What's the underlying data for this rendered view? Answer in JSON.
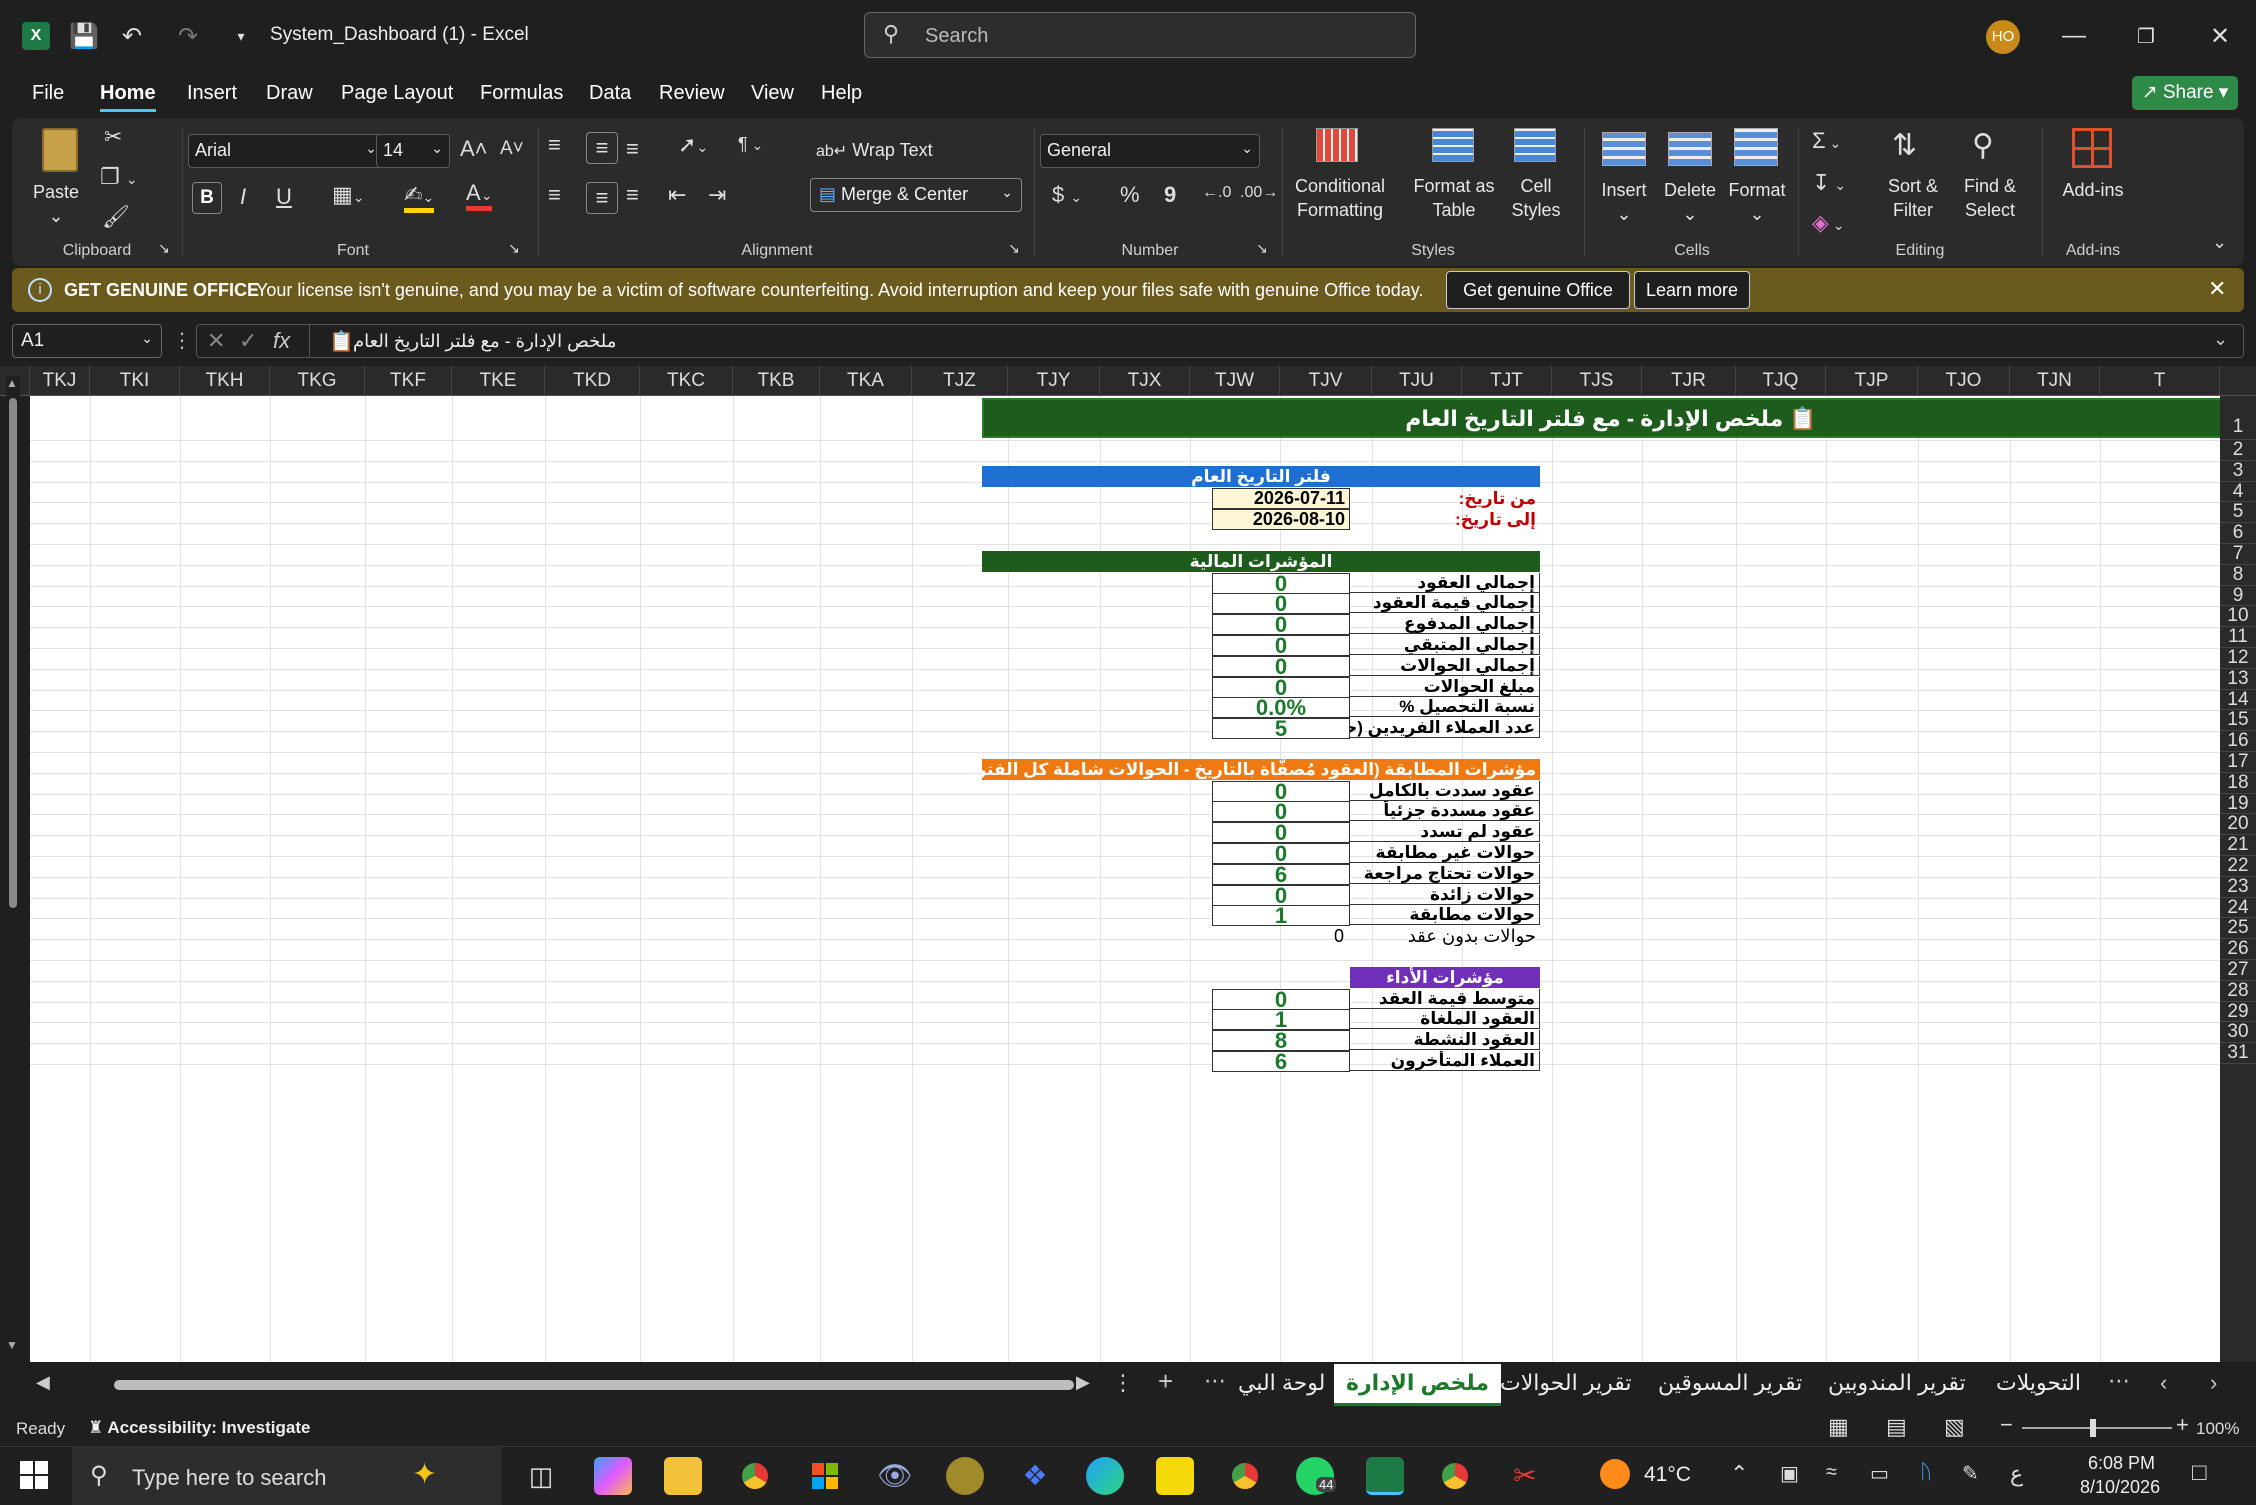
{
  "titlebar": {
    "filename": "System_Dashboard (1)",
    "app": "Excel",
    "search_placeholder": "Search",
    "user_initials": "HO"
  },
  "menu": {
    "items": [
      "File",
      "Home",
      "Insert",
      "Draw",
      "Page Layout",
      "Formulas",
      "Data",
      "Review",
      "View",
      "Help"
    ],
    "active": "Home",
    "share": "Share"
  },
  "ribbon": {
    "clipboard": {
      "paste": "Paste",
      "label": "Clipboard"
    },
    "font": {
      "name": "Arial",
      "size": "14",
      "label": "Font",
      "bold": "B",
      "italic": "I",
      "underline": "U"
    },
    "alignment": {
      "wrap": "Wrap Text",
      "merge": "Merge & Center",
      "label": "Alignment"
    },
    "number": {
      "format": "General",
      "label": "Number",
      "currency": "$",
      "percent": "%",
      "comma": "9"
    },
    "styles": {
      "conditional": "Conditional\nFormatting",
      "format_table": "Format as\nTable",
      "cell_styles": "Cell\nStyles",
      "label": "Styles"
    },
    "cells": {
      "insert": "Insert",
      "delete": "Delete",
      "format": "Format",
      "label": "Cells"
    },
    "editing": {
      "sort": "Sort &\nFilter",
      "find": "Find &\nSelect",
      "label": "Editing"
    },
    "addins": {
      "addins": "Add-ins",
      "label": "Add-ins"
    }
  },
  "notice": {
    "title": "GET GENUINE OFFICE",
    "message": "Your license isn't genuine, and you may be a victim of software counterfeiting. Avoid interruption and keep your files safe with genuine Office today.",
    "btn_primary": "Get genuine Office",
    "btn_secondary": "Learn more"
  },
  "formula_bar": {
    "name_box": "A1",
    "content": "ملخص الإدارة - مع فلتر التاريخ العام"
  },
  "columns": [
    "TKJ",
    "TKI",
    "TKH",
    "TKG",
    "TKF",
    "TKE",
    "TKD",
    "TKC",
    "TKB",
    "TKA",
    "TJZ",
    "TJY",
    "TJX",
    "TJW",
    "TJV",
    "TJU",
    "TJT",
    "TJS",
    "TJR",
    "TJQ",
    "TJP",
    "TJO",
    "TJN",
    "T"
  ],
  "rows": [
    "1",
    "2",
    "3",
    "4",
    "5",
    "6",
    "7",
    "8",
    "9",
    "10",
    "11",
    "12",
    "13",
    "14",
    "15",
    "16",
    "17",
    "18",
    "19",
    "20",
    "21",
    "22",
    "23",
    "24",
    "25",
    "26",
    "27",
    "28",
    "29",
    "30",
    "31"
  ],
  "sheet": {
    "title": "ملخص الإدارة - مع فلتر التاريخ العام",
    "date_filter_header": "فلتر التاريخ العام",
    "from_label": "من تاريخ:",
    "from_value": "2026-07-11",
    "to_label": "إلى تاريخ:",
    "to_value": "2026-08-10",
    "financial_header": "المؤشرات المالية",
    "financial": [
      {
        "label": "إجمالي العقود",
        "value": "0"
      },
      {
        "label": "إجمالي قيمة العقود",
        "value": "0"
      },
      {
        "label": "إجمالي المدفوع",
        "value": "0"
      },
      {
        "label": "إجمالي المتبقي",
        "value": "0"
      },
      {
        "label": "إجمالي الحوالات",
        "value": "0"
      },
      {
        "label": "مبلغ الحوالات",
        "value": "0"
      },
      {
        "label": "نسبة التحصيل %",
        "value": "0.0%"
      },
      {
        "label": "عدد العملاء الفريدين (حسب رقم العميل في",
        "value": "5"
      }
    ],
    "matching_header": "مؤشرات المطابقة  (العقود مُصفّاة بالتاريخ - الحوالات شاملة كل الفترات)",
    "matching": [
      {
        "label": "عقود سددت بالكامل",
        "value": "0"
      },
      {
        "label": "عقود مسددة جزئياً",
        "value": "0"
      },
      {
        "label": "عقود لم تسدد",
        "value": "0"
      },
      {
        "label": "حوالات غير مطابقة",
        "value": "0"
      },
      {
        "label": "حوالات تحتاج مراجعة",
        "value": "6"
      },
      {
        "label": "حوالات زائدة",
        "value": "0"
      },
      {
        "label": "حوالات مطابقة",
        "value": "1"
      }
    ],
    "no_contract_label": "حوالات بدون عقد",
    "no_contract_value": "0",
    "performance_header": "مؤشرات الأداء",
    "performance": [
      {
        "label": "متوسط قيمة العقد",
        "value": "0"
      },
      {
        "label": "العقود الملغاة",
        "value": "1"
      },
      {
        "label": "العقود النشطة",
        "value": "8"
      },
      {
        "label": "العملاء المتأخرون",
        "value": "6"
      }
    ]
  },
  "sheet_tabs": [
    "لوحة البي",
    "ملخص الإدارة",
    "تقرير الحوالات",
    "تقرير المسوقين",
    "تقرير المندوبين",
    "التحويلات"
  ],
  "active_sheet": "ملخص الإدارة",
  "status": {
    "ready": "Ready",
    "accessibility": "Accessibility: Investigate",
    "zoom": "100%"
  },
  "taskbar": {
    "search_placeholder": "Type here to search",
    "temperature": "41°C",
    "time": "6:08 PM",
    "date": "8/10/2026",
    "whatsapp_badge": "44",
    "lang": "ع"
  },
  "colors": {
    "green_header": "#1e5c1e",
    "blue_header": "#1f6fd1",
    "orange_header": "#f07a12",
    "purple_header": "#6f2fb8",
    "date_fill": "#fdf7d8",
    "red_label": "#c00000",
    "accent": "#4cc2ff"
  }
}
